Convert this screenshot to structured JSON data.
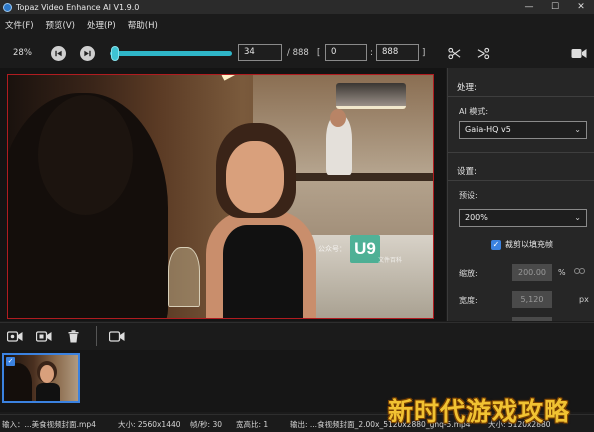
{
  "window": {
    "title": "Topaz Video Enhance AI V1.9.0",
    "controls": {
      "minimize": "—",
      "maximize": "☐",
      "close": "✕"
    }
  },
  "menu": [
    "文件(F)",
    "预览(V)",
    "处理(P)",
    "帮助(H)"
  ],
  "controls": {
    "zoom": "28%",
    "current_frame": "34",
    "total_frames": "/ 888",
    "range_open": "[",
    "range_start": "0",
    "range_sep": ":",
    "range_end": "888",
    "range_close": "]",
    "timeline_progress": 0.04
  },
  "preview": {
    "watermark_label": "公众号：",
    "watermark_logo": "U9",
    "watermark_sub": "文件百科"
  },
  "panel": {
    "process_header": "处理:",
    "ai_mode_label": "AI 模式:",
    "ai_mode_value": "Gaia-HQ v5",
    "settings_header": "设置:",
    "preset_label": "预设:",
    "preset_value": "200%",
    "crop_label": "裁剪以填充帧",
    "crop_checked": true,
    "scale_label": "缩放:",
    "scale_value": "200.00",
    "scale_unit": "%",
    "width_label": "宽度:",
    "width_value": "5,120",
    "width_unit": "px"
  },
  "status": {
    "input": "输入：...美食视频封面.mp4",
    "size": "大小: 2560x1440",
    "fps": "帧/秒: 30",
    "aspect": "宽高比: 1",
    "output": "输出: ...食视频封面_2.00x_5120x2880_ghq-5.mp4",
    "out_size": "大小: 5120x2880"
  },
  "overlay_brand": "新时代游戏攻略",
  "colors": {
    "accent": "#3b82e0",
    "slider": "#2fb6c8",
    "frame_border": "#b01c20"
  }
}
